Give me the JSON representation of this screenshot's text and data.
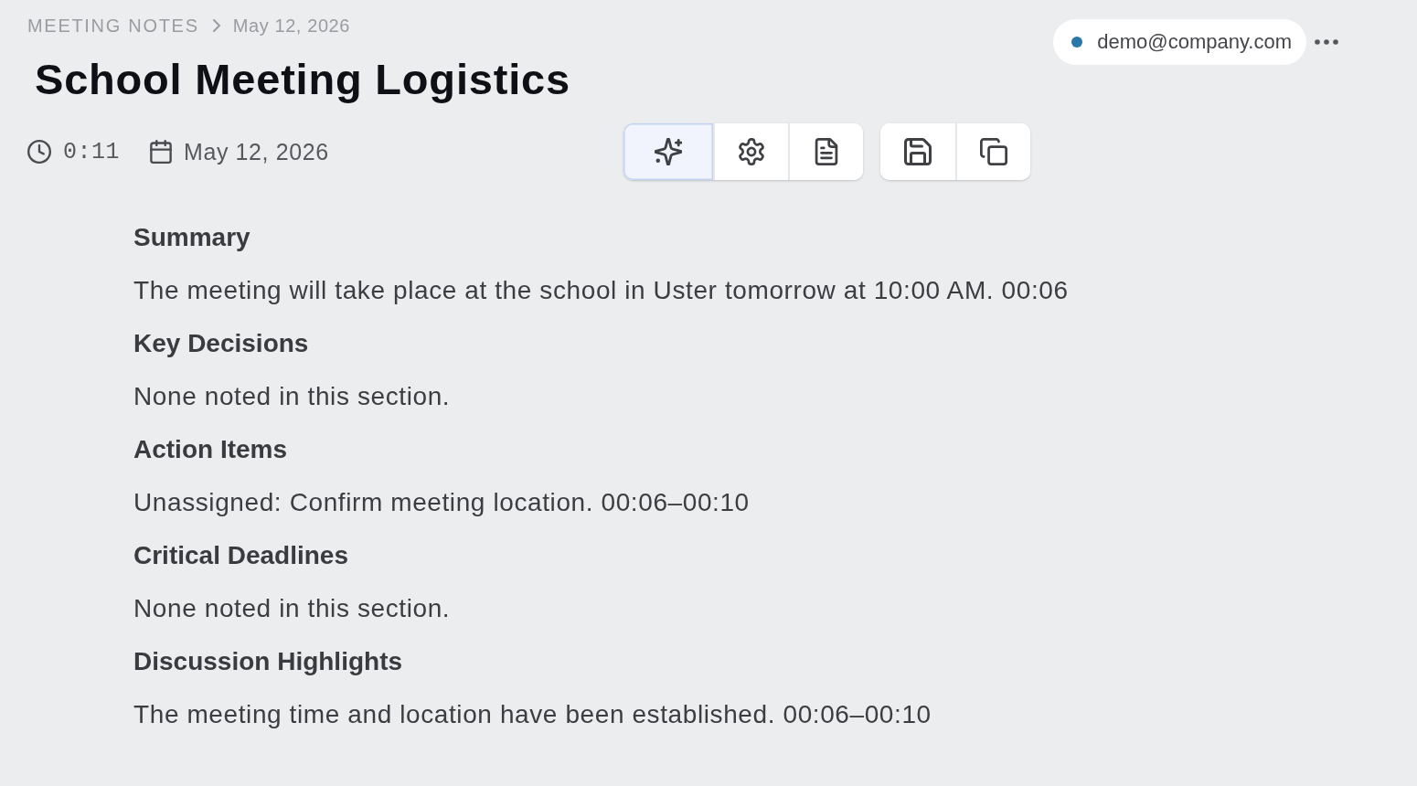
{
  "breadcrumb": {
    "section": "MEETING NOTES",
    "current": "May 12, 2026"
  },
  "account": {
    "email": "demo@company.com"
  },
  "title": "School Meeting Logistics",
  "meta": {
    "duration": "0:11",
    "date": "May 12, 2026"
  },
  "toolbar": {
    "groups": [
      [
        {
          "kind": "sparkle",
          "selected": true
        },
        {
          "kind": "settings",
          "selected": false
        },
        {
          "kind": "document",
          "selected": false
        }
      ],
      [
        {
          "kind": "save",
          "selected": false
        },
        {
          "kind": "copy",
          "selected": false
        }
      ]
    ]
  },
  "sections": [
    {
      "heading": "Summary",
      "text": "The meeting will take place at the school in Uster tomorrow at 10:00 AM. 00:06"
    },
    {
      "heading": "Key Decisions",
      "text": "None noted in this section."
    },
    {
      "heading": "Action Items",
      "text": "Unassigned: Confirm meeting location. 00:06–00:10"
    },
    {
      "heading": "Critical Deadlines",
      "text": "None noted in this section."
    },
    {
      "heading": "Discussion Highlights",
      "text": "The meeting time and location have been established. 00:06–00:10"
    }
  ]
}
